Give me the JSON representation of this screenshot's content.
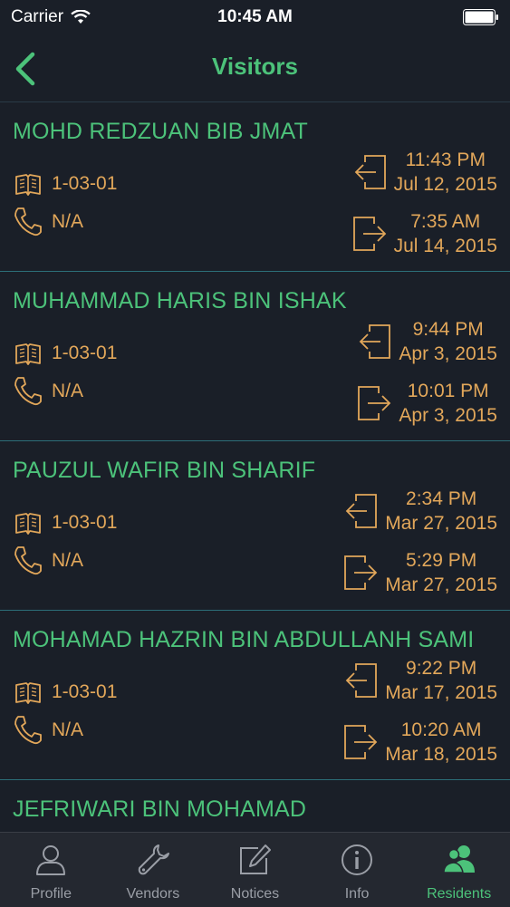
{
  "status_bar": {
    "carrier": "Carrier",
    "time": "10:45 AM"
  },
  "nav": {
    "title": "Visitors",
    "back_icon": "chevron-left-icon"
  },
  "colors": {
    "accent": "#4cc27a",
    "detail": "#e2a75a",
    "background": "#1a1f28",
    "divider": "#2c6e78"
  },
  "visitors": [
    {
      "name": "MOHD REDZUAN BIB JMAT",
      "unit": "1-03-01",
      "phone": "N/A",
      "in_time": "11:43 PM",
      "in_date": "Jul 12, 2015",
      "out_time": "7:35 AM",
      "out_date": "Jul 14, 2015"
    },
    {
      "name": "MUHAMMAD HARIS BIN ISHAK",
      "unit": "1-03-01",
      "phone": "N/A",
      "in_time": "9:44 PM",
      "in_date": "Apr 3, 2015",
      "out_time": "10:01 PM",
      "out_date": "Apr 3, 2015"
    },
    {
      "name": "PAUZUL WAFIR BIN SHARIF",
      "unit": "1-03-01",
      "phone": "N/A",
      "in_time": "2:34 PM",
      "in_date": "Mar 27, 2015",
      "out_time": "5:29 PM",
      "out_date": "Mar 27, 2015"
    },
    {
      "name": "MOHAMAD HAZRIN BIN ABDULLANH SAMI",
      "unit": "1-03-01",
      "phone": "N/A",
      "in_time": "9:22 PM",
      "in_date": "Mar 17, 2015",
      "out_time": "10:20 AM",
      "out_date": "Mar 18, 2015"
    },
    {
      "name": "JEFRIWARI BIN MOHAMAD",
      "unit": "",
      "phone": "",
      "in_time": "",
      "in_date": "",
      "out_time": "",
      "out_date": ""
    }
  ],
  "tabs": [
    {
      "label": "Profile",
      "icon": "user-icon",
      "active": false
    },
    {
      "label": "Vendors",
      "icon": "wrench-icon",
      "active": false
    },
    {
      "label": "Notices",
      "icon": "edit-icon",
      "active": false
    },
    {
      "label": "Info",
      "icon": "info-icon",
      "active": false
    },
    {
      "label": "Residents",
      "icon": "residents-icon",
      "active": true
    }
  ]
}
